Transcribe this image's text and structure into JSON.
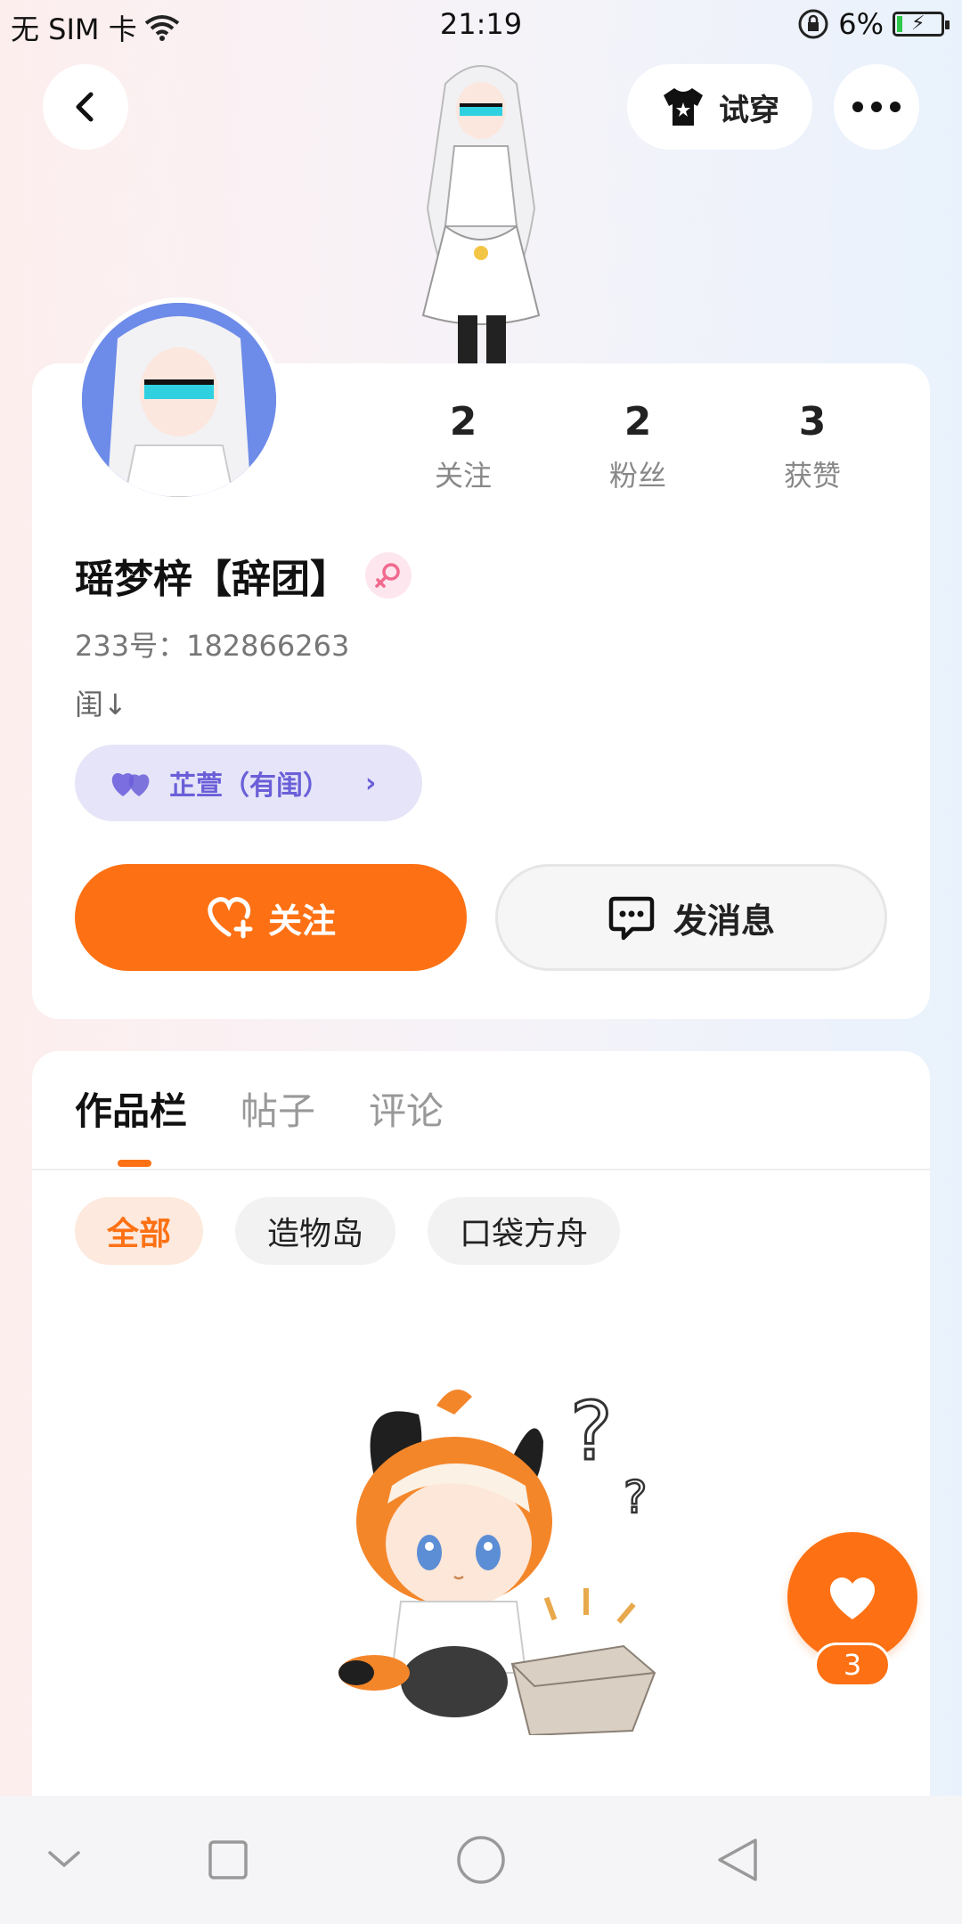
{
  "status_bar": {
    "carrier": "无 SIM 卡",
    "time": "21:19",
    "battery": "6%"
  },
  "top_bar": {
    "try_on_label": "试穿"
  },
  "profile": {
    "stats": [
      {
        "value": "2",
        "label": "关注"
      },
      {
        "value": "2",
        "label": "粉丝"
      },
      {
        "value": "3",
        "label": "获赞"
      }
    ],
    "name": "瑶梦梓【辞团】",
    "uid": "233号：182866263",
    "bio": "闺↓",
    "relation": "芷萱（有闺）",
    "follow_label": "关注",
    "message_label": "发消息"
  },
  "works": {
    "tabs": [
      "作品栏",
      "帖子",
      "评论"
    ],
    "filters": [
      "全部",
      "造物岛",
      "口袋方舟"
    ]
  },
  "like_fab": {
    "count": "3"
  },
  "colors": {
    "accent": "#fd7114",
    "relation_text": "#6a5fd8",
    "relation_bg": "#e5e4f8"
  }
}
